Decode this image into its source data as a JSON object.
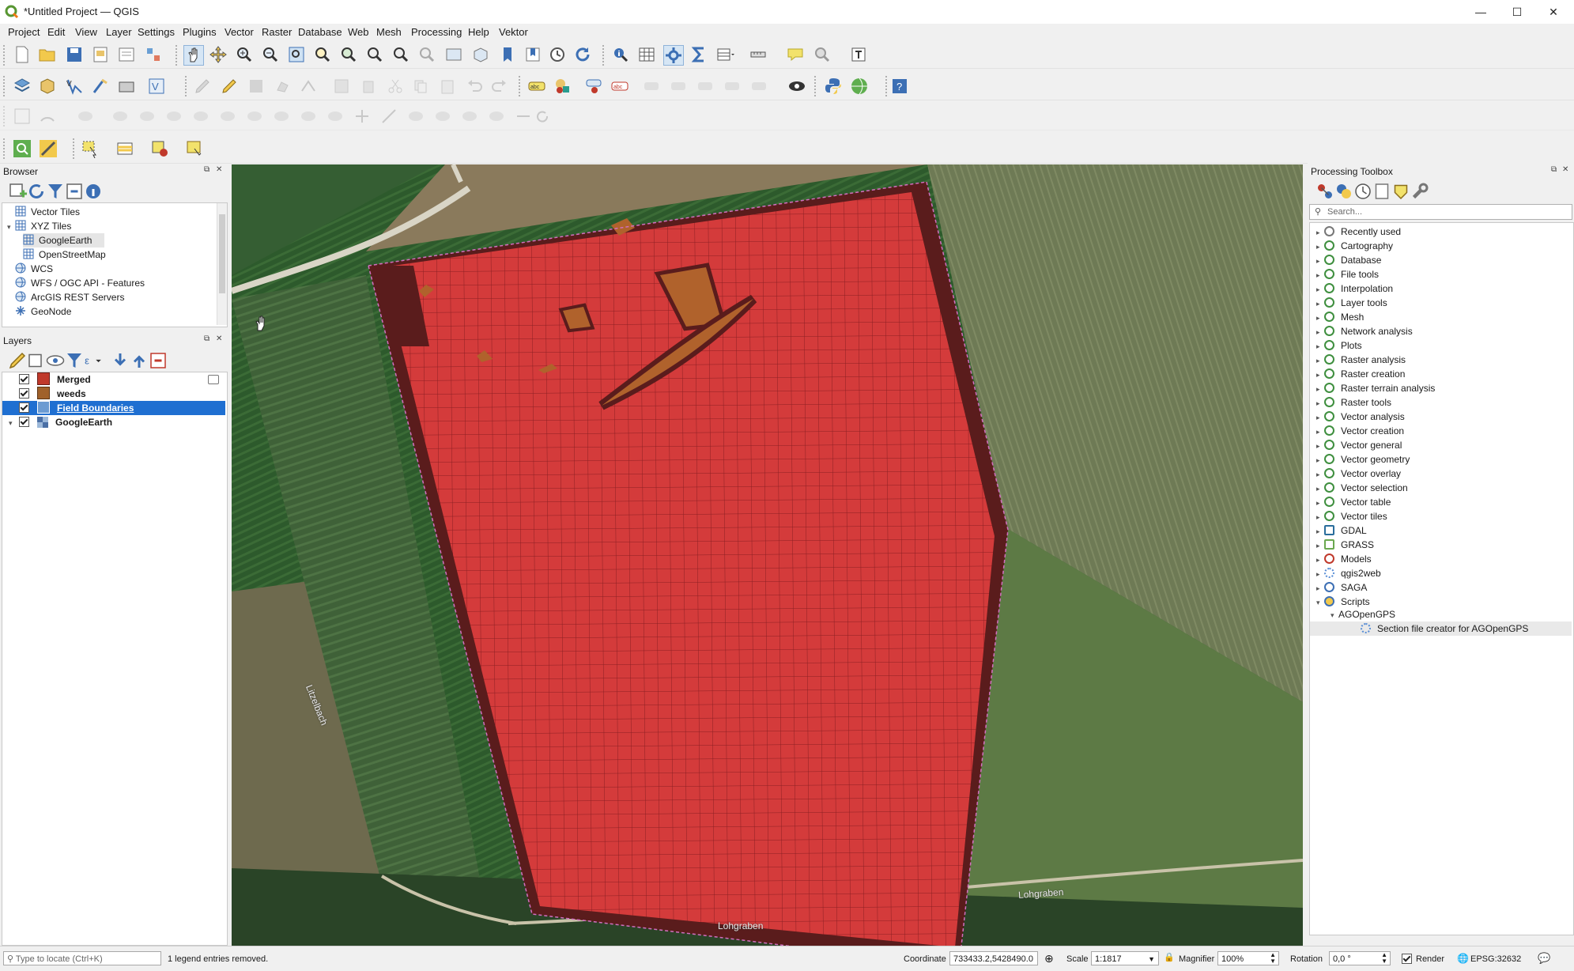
{
  "window": {
    "title": "*Untitled Project — QGIS",
    "minimize_label": "—",
    "maximize_label": "☐",
    "close_label": "✕"
  },
  "menu": [
    "Project",
    "Edit",
    "View",
    "Layer",
    "Settings",
    "Plugins",
    "Vector",
    "Raster",
    "Database",
    "Web",
    "Mesh",
    "Processing",
    "Help",
    "Vektor"
  ],
  "browser": {
    "title": "Browser",
    "items": [
      {
        "label": "Vector Tiles",
        "icon": "grid-icon",
        "level": 0,
        "arrow": ""
      },
      {
        "label": "XYZ Tiles",
        "icon": "grid-icon",
        "level": 0,
        "arrow": "▾"
      },
      {
        "label": "GoogleEarth",
        "icon": "grid-icon",
        "level": 1,
        "arrow": "",
        "selected": true
      },
      {
        "label": "OpenStreetMap",
        "icon": "grid-icon",
        "level": 1,
        "arrow": ""
      },
      {
        "label": "WCS",
        "icon": "globe-icon",
        "level": 0,
        "arrow": ""
      },
      {
        "label": "WFS / OGC API - Features",
        "icon": "globe-icon",
        "level": 0,
        "arrow": ""
      },
      {
        "label": "ArcGIS REST Servers",
        "icon": "globe-icon",
        "level": 0,
        "arrow": ""
      },
      {
        "label": "GeoNode",
        "icon": "geonode-icon",
        "level": 0,
        "arrow": ""
      }
    ]
  },
  "layers": {
    "title": "Layers",
    "items": [
      {
        "label": "Merged",
        "color": "#c0392b",
        "checked": true,
        "bold": true,
        "selected": false,
        "arrow": ""
      },
      {
        "label": "weeds",
        "color": "#a0612b",
        "checked": true,
        "bold": true,
        "selected": false,
        "arrow": ""
      },
      {
        "label": "Field Boundaries",
        "color": "#6b9bd2",
        "checked": true,
        "bold": false,
        "selected": true,
        "arrow": ""
      },
      {
        "label": "GoogleEarth",
        "color": "#4a6fa5",
        "checked": true,
        "bold": true,
        "selected": false,
        "arrow": "▾"
      }
    ]
  },
  "map": {
    "labels": {
      "litzelbach": "Litzelbach",
      "lohgraben_1": "Lohgraben",
      "lohgraben_2": "Lohgraben"
    },
    "colors": {
      "cell_fill": "#d43b3b",
      "cell_stroke": "#8a1e22",
      "field_dark": "#5a1c1c",
      "weeds": "#b0622c",
      "boundary": "#d16fbf"
    }
  },
  "processing": {
    "title": "Processing Toolbox",
    "search_placeholder": "Search...",
    "items": [
      {
        "label": "Recently used",
        "icon": "clock-icon"
      },
      {
        "label": "Cartography",
        "icon": "qgis-icon"
      },
      {
        "label": "Database",
        "icon": "qgis-icon"
      },
      {
        "label": "File tools",
        "icon": "qgis-icon"
      },
      {
        "label": "Interpolation",
        "icon": "qgis-icon"
      },
      {
        "label": "Layer tools",
        "icon": "qgis-icon"
      },
      {
        "label": "Mesh",
        "icon": "qgis-icon"
      },
      {
        "label": "Network analysis",
        "icon": "qgis-icon"
      },
      {
        "label": "Plots",
        "icon": "qgis-icon"
      },
      {
        "label": "Raster analysis",
        "icon": "qgis-icon"
      },
      {
        "label": "Raster creation",
        "icon": "qgis-icon"
      },
      {
        "label": "Raster terrain analysis",
        "icon": "qgis-icon"
      },
      {
        "label": "Raster tools",
        "icon": "qgis-icon"
      },
      {
        "label": "Vector analysis",
        "icon": "qgis-icon"
      },
      {
        "label": "Vector creation",
        "icon": "qgis-icon"
      },
      {
        "label": "Vector general",
        "icon": "qgis-icon"
      },
      {
        "label": "Vector geometry",
        "icon": "qgis-icon"
      },
      {
        "label": "Vector overlay",
        "icon": "qgis-icon"
      },
      {
        "label": "Vector selection",
        "icon": "qgis-icon"
      },
      {
        "label": "Vector table",
        "icon": "qgis-icon"
      },
      {
        "label": "Vector tiles",
        "icon": "qgis-icon"
      },
      {
        "label": "GDAL",
        "icon": "gdal-icon"
      },
      {
        "label": "GRASS",
        "icon": "grass-icon"
      },
      {
        "label": "Models",
        "icon": "models-icon"
      },
      {
        "label": "qgis2web",
        "icon": "plugin-icon"
      },
      {
        "label": "SAGA",
        "icon": "saga-icon"
      },
      {
        "label": "Scripts",
        "icon": "python-icon",
        "expanded": true
      },
      {
        "label": "AGOpenGPS",
        "icon": "",
        "child": 1,
        "expanded": true
      },
      {
        "label": "Section file creator for AGOpenGPS",
        "icon": "plugin-icon",
        "child": 2
      }
    ]
  },
  "status": {
    "locate_placeholder": "Type to locate (Ctrl+K)",
    "message": "1 legend entries removed.",
    "coordinate_label": "Coordinate",
    "coordinate_value": "733433.2,5428490.0",
    "scale_label": "Scale",
    "scale_value": "1:1817",
    "magnifier_label": "Magnifier",
    "magnifier_value": "100%",
    "rotation_label": "Rotation",
    "rotation_value": "0,0 °",
    "render_label": "Render",
    "crs_label": "EPSG:32632"
  }
}
